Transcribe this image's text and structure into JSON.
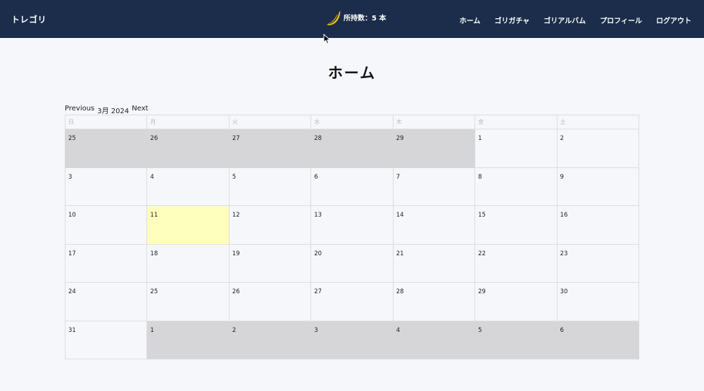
{
  "header": {
    "brand": "トレゴリ",
    "banana_count": "所持数：5 本",
    "nav": [
      "ホーム",
      "ゴリガチャ",
      "ゴリアルバム",
      "プロフィール",
      "ログアウト"
    ]
  },
  "page_title": "ホーム",
  "calendar": {
    "prev": "Previous",
    "month_label": "3月 2024",
    "next": "Next",
    "weekdays": [
      "日",
      "月",
      "火",
      "水",
      "木",
      "金",
      "土"
    ],
    "weeks": [
      [
        {
          "d": "25",
          "other": true
        },
        {
          "d": "26",
          "other": true
        },
        {
          "d": "27",
          "other": true
        },
        {
          "d": "28",
          "other": true
        },
        {
          "d": "29",
          "other": true
        },
        {
          "d": "1"
        },
        {
          "d": "2"
        }
      ],
      [
        {
          "d": "3"
        },
        {
          "d": "4"
        },
        {
          "d": "5"
        },
        {
          "d": "6"
        },
        {
          "d": "7"
        },
        {
          "d": "8"
        },
        {
          "d": "9"
        }
      ],
      [
        {
          "d": "10"
        },
        {
          "d": "11",
          "today": true
        },
        {
          "d": "12"
        },
        {
          "d": "13"
        },
        {
          "d": "14"
        },
        {
          "d": "15"
        },
        {
          "d": "16"
        }
      ],
      [
        {
          "d": "17"
        },
        {
          "d": "18"
        },
        {
          "d": "19"
        },
        {
          "d": "20"
        },
        {
          "d": "21"
        },
        {
          "d": "22"
        },
        {
          "d": "23"
        }
      ],
      [
        {
          "d": "24"
        },
        {
          "d": "25"
        },
        {
          "d": "26"
        },
        {
          "d": "27"
        },
        {
          "d": "28"
        },
        {
          "d": "29"
        },
        {
          "d": "30"
        }
      ],
      [
        {
          "d": "31"
        },
        {
          "d": "1",
          "other": true
        },
        {
          "d": "2",
          "other": true
        },
        {
          "d": "3",
          "other": true
        },
        {
          "d": "4",
          "other": true
        },
        {
          "d": "5",
          "other": true
        },
        {
          "d": "6",
          "other": true
        }
      ]
    ]
  },
  "colors": {
    "navbar": "#1b2d4a",
    "other_month": "#d6d6d8",
    "today": "#feffbd"
  }
}
